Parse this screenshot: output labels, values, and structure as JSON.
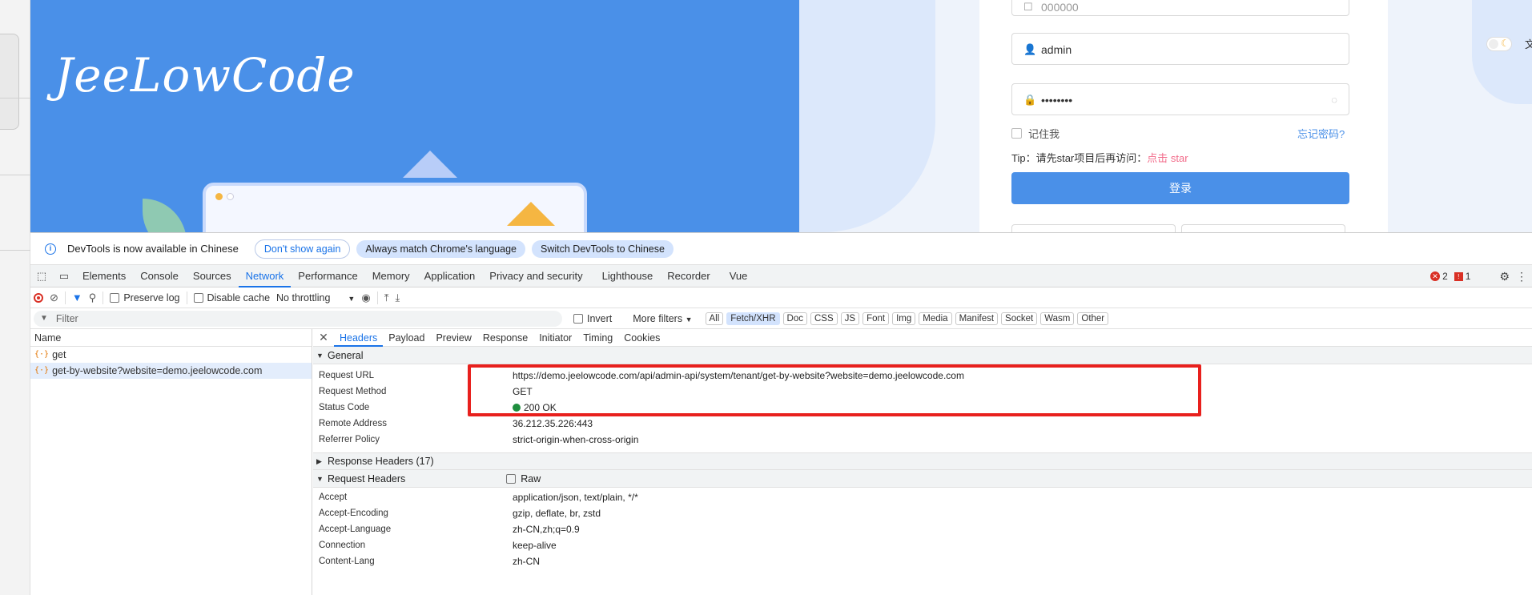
{
  "page": {
    "logo_text": "JeeLowCode",
    "form": {
      "tenant_value": "000000",
      "username_value": "admin",
      "password_value": "••••••••",
      "remember_label": "记住我",
      "forgot_label": "忘记密码?",
      "tip_text": "Tip：请先star项目后再访问：",
      "tip_link": "点击 star",
      "login_label": "登录"
    },
    "lang_char": "文"
  },
  "devtools": {
    "infobar": {
      "message": "DevTools is now available in Chinese",
      "dont_show": "Don't show again",
      "always_match": "Always match Chrome's language",
      "switch": "Switch DevTools to Chinese"
    },
    "tabs": [
      "Elements",
      "Console",
      "Sources",
      "Network",
      "Performance",
      "Memory",
      "Application",
      "Privacy and security",
      "Lighthouse",
      "Recorder",
      "Vue"
    ],
    "active_tab": "Network",
    "errors_count": "2",
    "issues_count": "1",
    "toolbar": {
      "preserve_log": "Preserve log",
      "disable_cache": "Disable cache",
      "throttling": "No throttling"
    },
    "filter": {
      "placeholder": "Filter",
      "invert": "Invert",
      "more_filters": "More filters",
      "types": [
        "All",
        "Fetch/XHR",
        "Doc",
        "CSS",
        "JS",
        "Font",
        "Img",
        "Media",
        "Manifest",
        "Socket",
        "Wasm",
        "Other"
      ],
      "selected_type": "Fetch/XHR"
    },
    "list": {
      "header": "Name",
      "rows": [
        "get",
        "get-by-website?website=demo.jeelowcode.com"
      ]
    },
    "detail": {
      "tabs": [
        "Headers",
        "Payload",
        "Preview",
        "Response",
        "Initiator",
        "Timing",
        "Cookies"
      ],
      "active_tab": "Headers",
      "general_title": "General",
      "general": [
        {
          "k": "Request URL",
          "v": "https://demo.jeelowcode.com/api/admin-api/system/tenant/get-by-website?website=demo.jeelowcode.com"
        },
        {
          "k": "Request Method",
          "v": "GET"
        },
        {
          "k": "Status Code",
          "v": "200 OK"
        },
        {
          "k": "Remote Address",
          "v": "36.212.35.226:443"
        },
        {
          "k": "Referrer Policy",
          "v": "strict-origin-when-cross-origin"
        }
      ],
      "response_headers_title": "Response Headers (17)",
      "request_headers_title": "Request Headers",
      "raw_label": "Raw",
      "request_headers": [
        {
          "k": "Accept",
          "v": "application/json, text/plain, */*"
        },
        {
          "k": "Accept-Encoding",
          "v": "gzip, deflate, br, zstd"
        },
        {
          "k": "Accept-Language",
          "v": "zh-CN,zh;q=0.9"
        },
        {
          "k": "Connection",
          "v": "keep-alive"
        },
        {
          "k": "Content-Lang",
          "v": "zh-CN"
        }
      ]
    }
  }
}
